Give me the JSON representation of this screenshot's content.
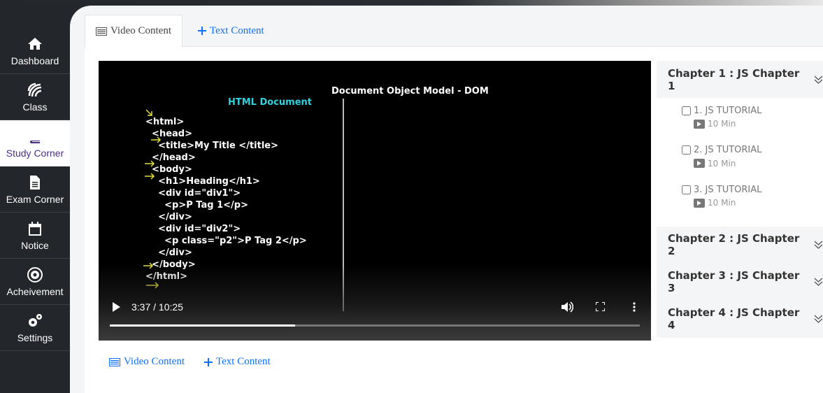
{
  "sidebar": {
    "items": [
      {
        "label": "Dashboard",
        "icon": "home-icon"
      },
      {
        "label": "Class",
        "icon": "class-icon"
      },
      {
        "label": "Study Corner",
        "icon": "book-icon"
      },
      {
        "label": "Exam Corner",
        "icon": "document-icon"
      },
      {
        "label": "Notice",
        "icon": "calendar-icon"
      },
      {
        "label": "Acheivement",
        "icon": "achievement-icon"
      },
      {
        "label": "Settings",
        "icon": "gears-icon"
      }
    ]
  },
  "tabs": {
    "video": "Video Content",
    "text": "Text Content"
  },
  "video": {
    "slide_title": "Document Object Model - DOM",
    "slide_subtitle": "HTML Document",
    "code_lines": [
      "<html>",
      "  <head>",
      "    <title>My Title </title>",
      "  </head>",
      "  <body>",
      "    <h1>Heading</h1>",
      "    <div id=\"div1\">",
      "      <p>P Tag 1</p>",
      "    </div>",
      "    <div id=\"div2\">",
      "      <p class=\"p2\">P Tag 2</p>",
      "    </div>",
      "  </body>",
      "</html>"
    ],
    "time": "3:37 / 10:25",
    "progress": 0.35
  },
  "bottom_links": {
    "video": "Video Content",
    "text": "Text Content"
  },
  "chapters": [
    {
      "title": "Chapter 1 : JS Chapter 1",
      "lessons": [
        {
          "title": "1. JS TUTORIAL",
          "duration": "10 Min"
        },
        {
          "title": "2. JS TUTORIAL",
          "duration": "10 Min"
        },
        {
          "title": "3. JS TUTORIAL",
          "duration": "10 Min"
        }
      ]
    },
    {
      "title": "Chapter 2 : JS Chapter 2"
    },
    {
      "title": "Chapter 3 : JS Chapter 3"
    },
    {
      "title": "Chapter 4 : JS Chapter 4"
    }
  ],
  "colors": {
    "accent": "#0d6efd",
    "active_sidebar": "#4b2f86",
    "sidebar_bg": "#23272b"
  }
}
